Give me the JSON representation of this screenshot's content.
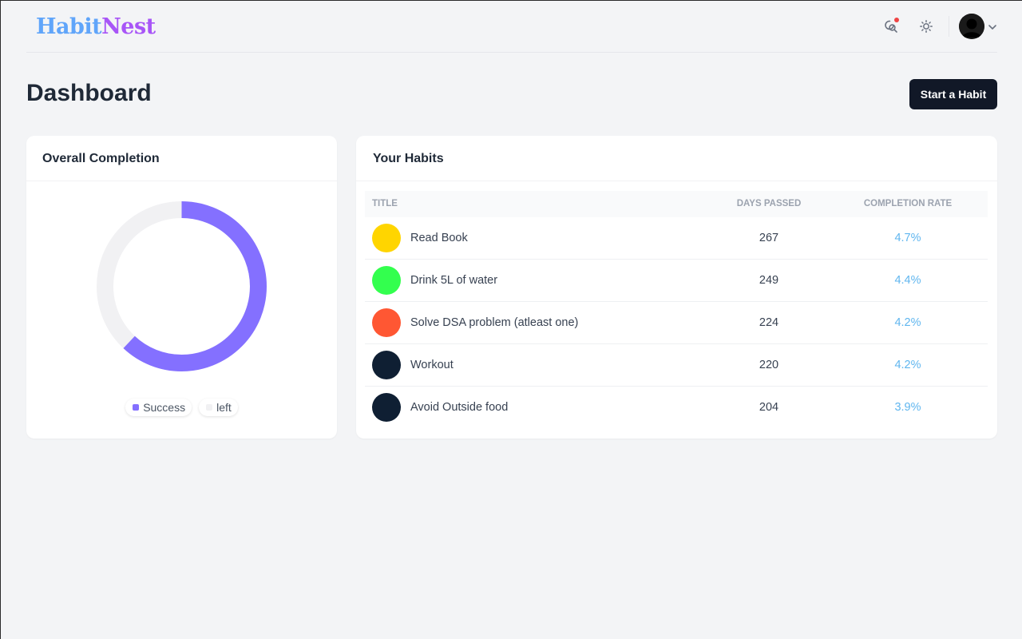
{
  "brand": {
    "part1": "Habit",
    "part2": "Nest"
  },
  "header": {
    "title": "Dashboard",
    "start_button": "Start a Habit"
  },
  "overall": {
    "title": "Overall Completion",
    "success_fraction": 0.62,
    "legend": [
      {
        "label": "Success",
        "color": "#8470ff"
      },
      {
        "label": "left",
        "color": "#f1f1f3"
      }
    ]
  },
  "habits": {
    "title": "Your Habits",
    "columns": [
      "Title",
      "Days Passed",
      "Completion Rate"
    ],
    "rows": [
      {
        "title": "Read Book",
        "days": "267",
        "rate": "4.7%",
        "color": "#ffd500"
      },
      {
        "title": "Drink 5L of water",
        "days": "249",
        "rate": "4.4%",
        "color": "#33ff4e"
      },
      {
        "title": "Solve DSA problem (atleast one)",
        "days": "224",
        "rate": "4.2%",
        "color": "#ff5733"
      },
      {
        "title": "Workout",
        "days": "220",
        "rate": "4.2%",
        "color": "#0f1f33"
      },
      {
        "title": "Avoid Outside food",
        "days": "204",
        "rate": "3.9%",
        "color": "#0f1f33"
      }
    ]
  },
  "icons": [
    "search-notification-icon",
    "sun-icon",
    "user-avatar",
    "chevron-down-icon"
  ]
}
